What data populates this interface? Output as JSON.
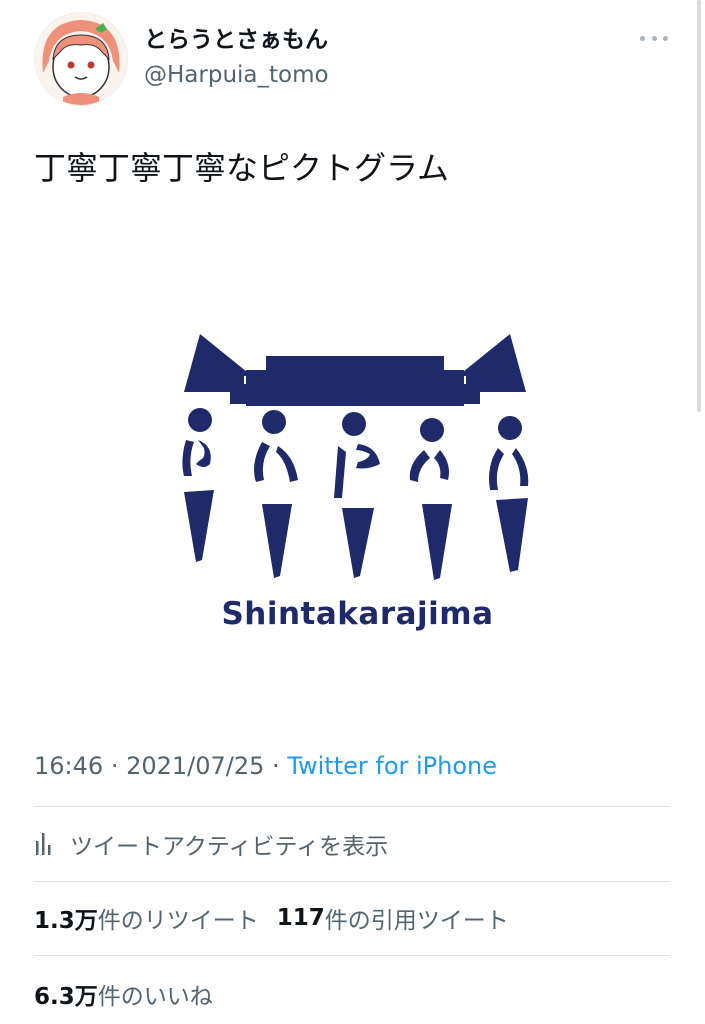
{
  "tweet": {
    "display_name": "とらうとさぁもん",
    "handle": "@Harpuia_tomo",
    "text": "丁寧丁寧丁寧なピクトグラム",
    "media": {
      "logo_caption": "Shintakarajima",
      "colors": {
        "logo_navy": "#1f2a6b"
      }
    },
    "time": "16:46",
    "separator": "·",
    "date": "2021/07/25",
    "source": "Twitter for iPhone",
    "activity_label": "ツイートアクティビティを表示",
    "retweets_count": "1.3万",
    "retweets_label": "件のリツイート",
    "quotes_count": "117",
    "quotes_label": "件の引用ツイート",
    "likes_count": "6.3万",
    "likes_label": "件のいいね"
  },
  "icons": {
    "more": "more-horizontal-icon",
    "activity": "bar-chart-icon"
  },
  "colors": {
    "link": "#1d9bf0",
    "secondary_text": "#536471",
    "primary_text": "#0f1419",
    "divider": "#dfe3e6"
  }
}
